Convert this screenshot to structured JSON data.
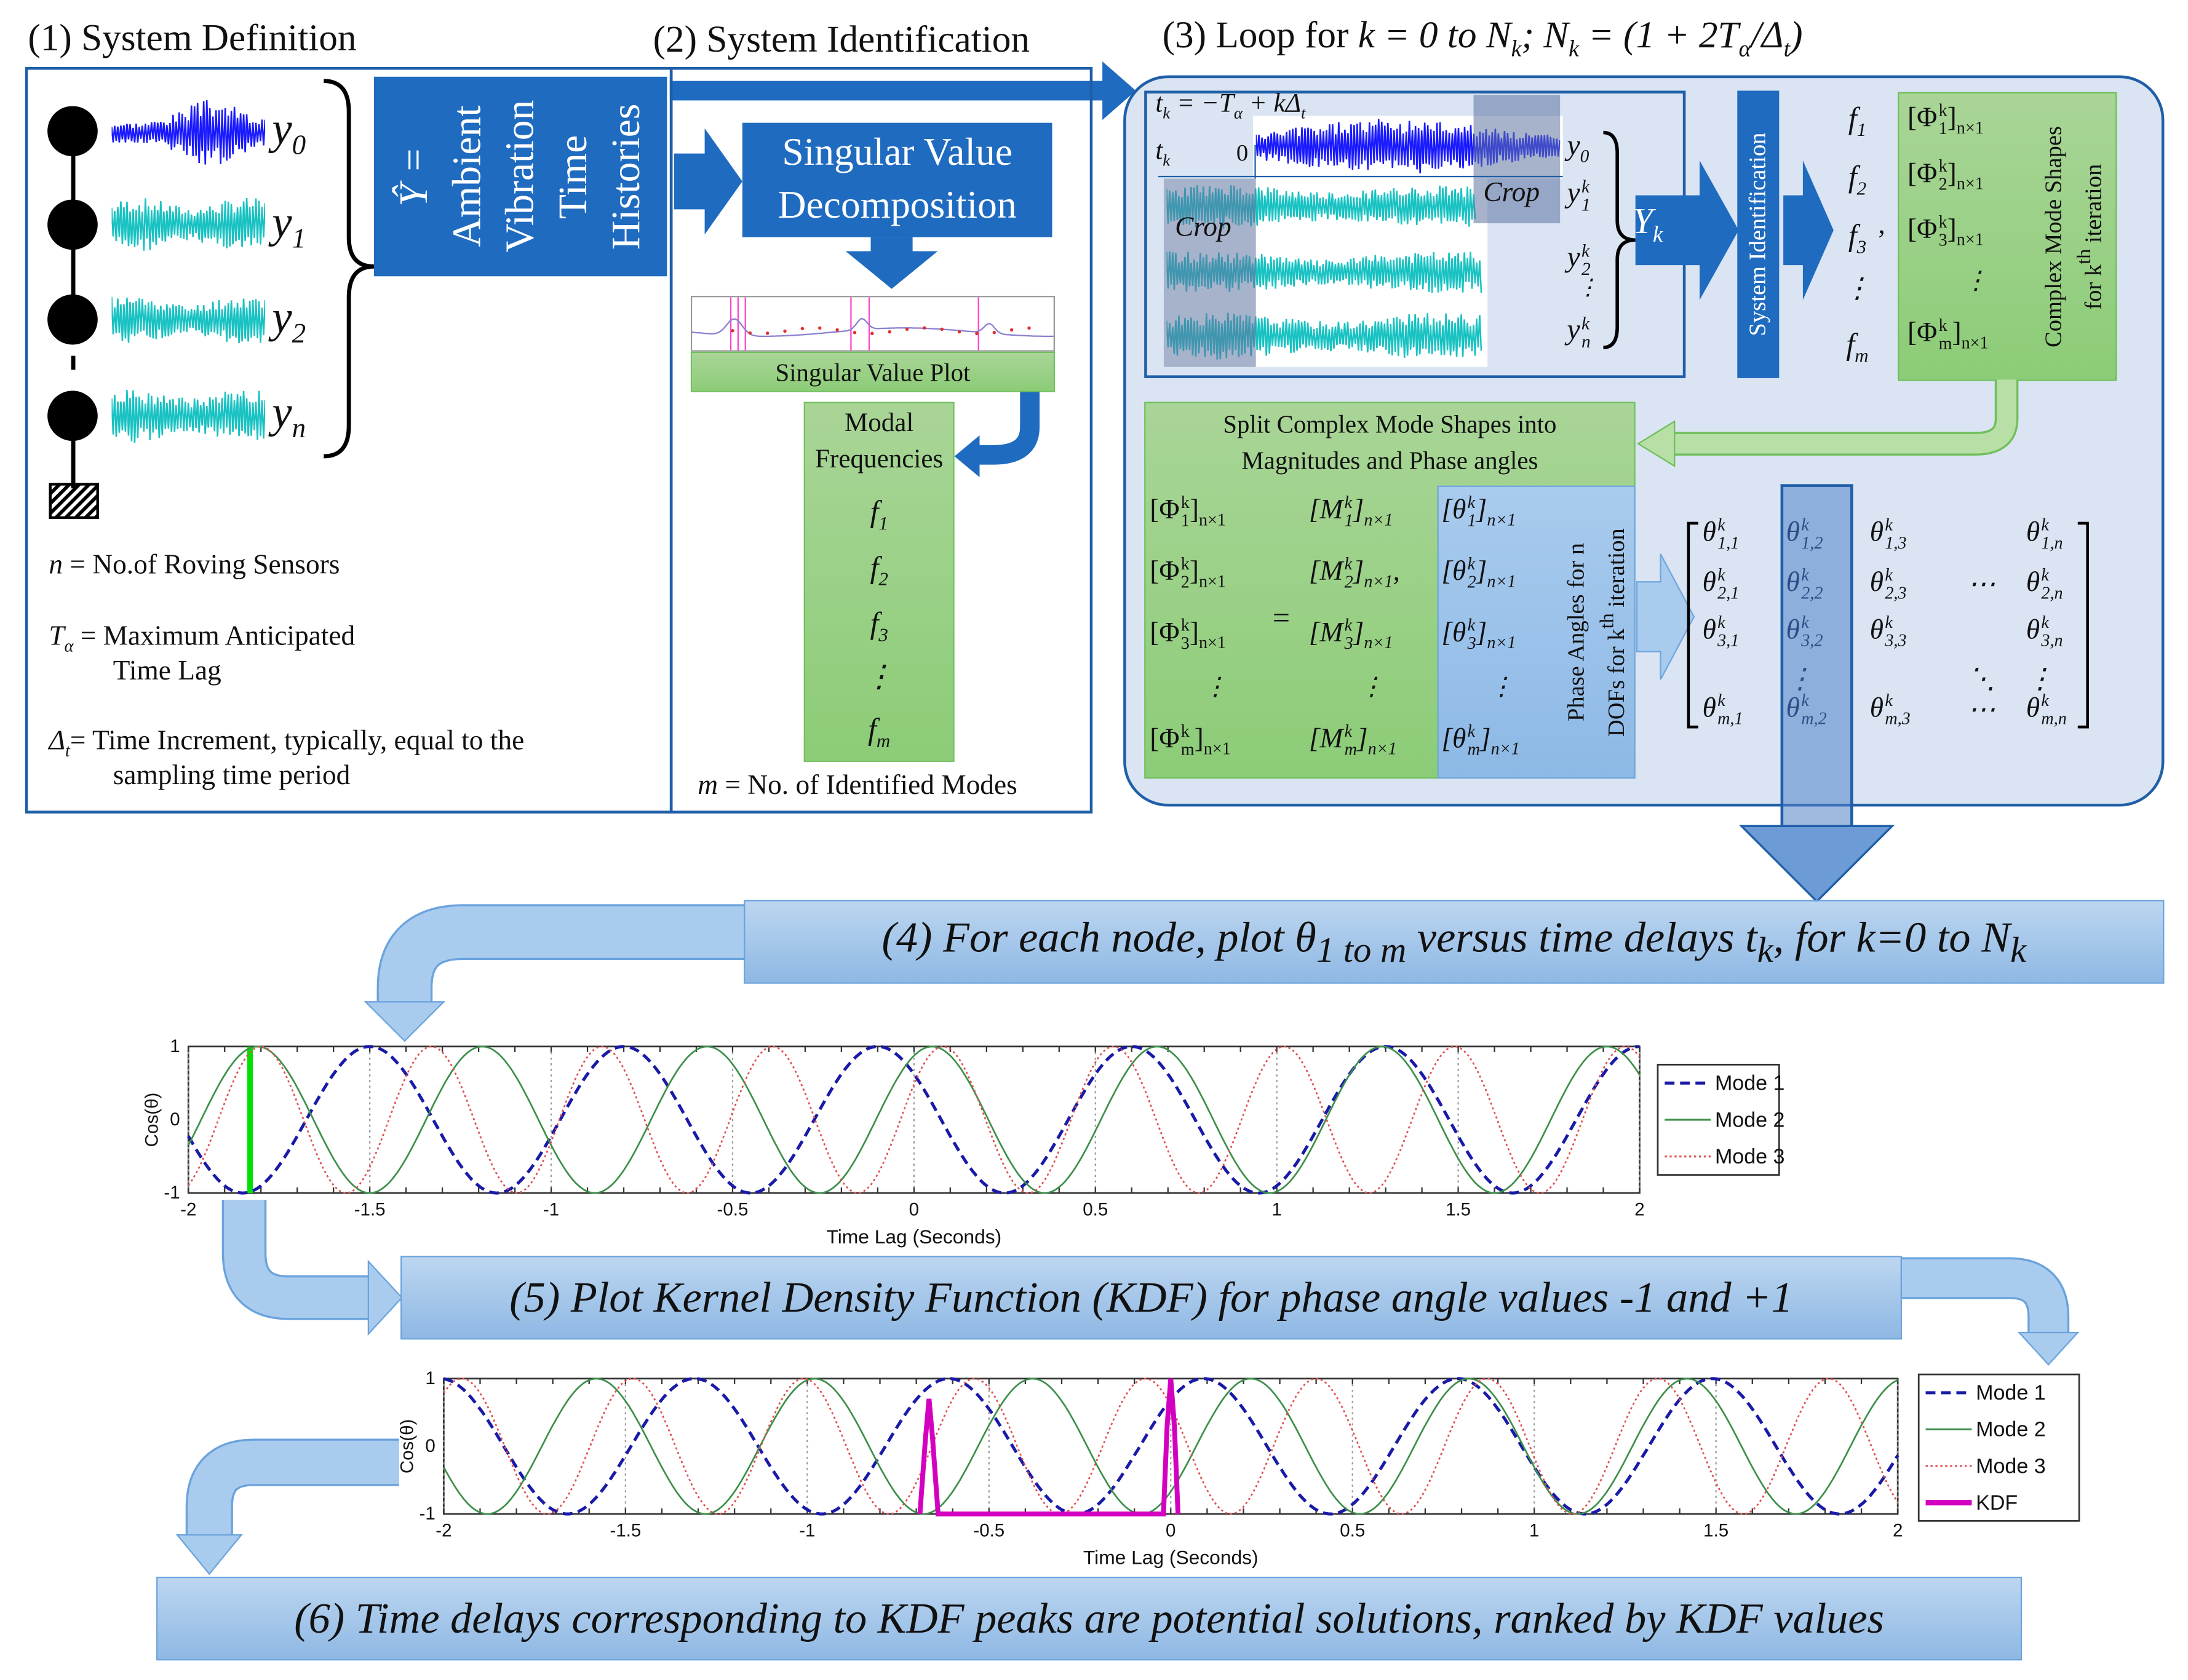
{
  "section1": {
    "title": "(1) System Definition",
    "sensors": [
      [
        {
          "t": "y",
          "sub": "0"
        }
      ],
      [
        {
          "t": "y",
          "sub": "1"
        }
      ],
      [
        {
          "t": "y",
          "sub": "2"
        }
      ],
      [
        {
          "t": "y",
          "sub": "n"
        }
      ]
    ],
    "yhat": {
      "symbol": "Ŷ =",
      "lines": [
        "Ambient",
        "Vibration",
        "Time",
        "Histories"
      ]
    },
    "definitions": [
      {
        "sym": [
          {
            "t": "n"
          }
        ],
        "text": "= No.of Roving Sensors",
        "text2": ""
      },
      {
        "sym": [
          {
            "t": "T",
            "sub": "α"
          }
        ],
        "text": "= Maximum Anticipated",
        "text2": "Time Lag"
      },
      {
        "sym": [
          {
            "t": "Δ",
            "sub": "t"
          }
        ],
        "text": "= Time Increment, typically, equal to the",
        "text2": "sampling time period"
      }
    ],
    "colors": {
      "reference_signal": "#1a1aff",
      "roving_signal": "#19c2c2"
    }
  },
  "section2": {
    "title": "(2) System Identification",
    "svd_lines": [
      "Singular Value",
      "Decomposition"
    ],
    "sv_plot_label": "Singular Value Plot",
    "modal_title": [
      "Modal",
      "Frequencies"
    ],
    "frequencies": [
      [
        {
          "t": "f",
          "sub": "1"
        }
      ],
      [
        {
          "t": "f",
          "sub": "2"
        }
      ],
      [
        {
          "t": "f",
          "sub": "3"
        }
      ],
      [
        {
          "t": "⋮"
        }
      ],
      [
        {
          "t": "f",
          "sub": "m"
        }
      ]
    ],
    "footnote_sym": [
      {
        "t": "m"
      }
    ],
    "footnote_text": "= No. of Identified Modes"
  },
  "section3": {
    "title_prefix": "(3) Loop for ",
    "title_math": [
      {
        "t": "k"
      },
      {
        "t": " = 0 "
      },
      {
        "t": "to N",
        "sub": "k"
      },
      {
        "t": "; N",
        "sub": "k"
      },
      {
        "t": " = (1 + 2T",
        "sub": "α"
      },
      {
        "t": "/Δ",
        "sub": "t"
      },
      {
        "t": ")"
      }
    ],
    "tk_equation": [
      {
        "t": "t",
        "sub": "k"
      },
      {
        "t": " = −T",
        "sub": "α"
      },
      {
        "t": " + kΔ",
        "sub": "t"
      }
    ],
    "tk_axis": [
      {
        "t": "t",
        "sub": "k"
      }
    ],
    "zero": "0",
    "crop_label": "Crop",
    "signal_labels": [
      [
        {
          "t": "y",
          "sub": "0"
        }
      ],
      [
        {
          "t": "y",
          "sup": "k",
          "sub": "1"
        }
      ],
      [
        {
          "t": "y",
          "sup": "k",
          "sub": "2"
        }
      ],
      [
        {
          "t": "⋮"
        }
      ],
      [
        {
          "t": "y",
          "sup": "k",
          "sub": "n"
        }
      ]
    ],
    "yk": [
      {
        "t": "Y",
        "sub": "k"
      }
    ],
    "sysid_label": "System Identification",
    "frequencies": [
      [
        {
          "t": "f",
          "sub": "1"
        }
      ],
      [
        {
          "t": "f",
          "sub": "2"
        }
      ],
      [
        {
          "t": "f",
          "sub": "3"
        }
      ],
      [
        {
          "t": "⋮"
        }
      ],
      [
        {
          "t": "f",
          "sub": "m"
        }
      ]
    ],
    "comma": ",",
    "mode_shapes": [
      [
        {
          "t": "[Φ",
          "sup": "k",
          "sub": "1"
        },
        {
          "t": "]",
          "sub": "n×1"
        }
      ],
      [
        {
          "t": "[Φ",
          "sup": "k",
          "sub": "2"
        },
        {
          "t": "]",
          "sub": "n×1"
        }
      ],
      [
        {
          "t": "[Φ",
          "sup": "k",
          "sub": "3"
        },
        {
          "t": "]",
          "sub": "n×1"
        }
      ],
      [
        {
          "t": "⋮"
        }
      ],
      [
        {
          "t": "[Φ",
          "sup": "k",
          "sub": "m"
        },
        {
          "t": "]",
          "sub": "n×1"
        }
      ]
    ],
    "complex_label": [
      [
        {
          "t": "Complex Mode Shapes"
        }
      ],
      [
        {
          "t": "for k",
          "sup": "th"
        },
        {
          "t": " iteration"
        }
      ]
    ],
    "split_title": [
      "Split Complex Mode Shapes into",
      "Magnitudes and Phase angles"
    ],
    "phi_column": [
      [
        {
          "t": "[Φ",
          "sup": "k",
          "sub": "1"
        },
        {
          "t": "]",
          "sub": "n×1"
        }
      ],
      [
        {
          "t": "[Φ",
          "sup": "k",
          "sub": "2"
        },
        {
          "t": "]",
          "sub": "n×1"
        }
      ],
      [
        {
          "t": "[Φ",
          "sup": "k",
          "sub": "3"
        },
        {
          "t": "]",
          "sub": "n×1"
        }
      ],
      [
        {
          "t": "⋮"
        }
      ],
      [
        {
          "t": "[Φ",
          "sup": "k",
          "sub": "m"
        },
        {
          "t": "]",
          "sub": "n×1"
        }
      ]
    ],
    "equals": "=",
    "m_column": [
      [
        {
          "t": "[M",
          "sup": "k",
          "sub": "1"
        },
        {
          "t": "]",
          "sub": "n×1"
        }
      ],
      [
        {
          "t": "[M",
          "sup": "k",
          "sub": "2"
        },
        {
          "t": "]",
          "sub": "n×1"
        },
        {
          "t": ","
        }
      ],
      [
        {
          "t": "[M",
          "sup": "k",
          "sub": "3"
        },
        {
          "t": "]",
          "sub": "n×1"
        }
      ],
      [
        {
          "t": "⋮"
        }
      ],
      [
        {
          "t": "[M",
          "sup": "k",
          "sub": "m"
        },
        {
          "t": "]",
          "sub": "n×1"
        }
      ]
    ],
    "theta_column": [
      [
        {
          "t": "[θ",
          "sup": "k",
          "sub": "1"
        },
        {
          "t": "]",
          "sub": "n×1"
        }
      ],
      [
        {
          "t": "[θ",
          "sup": "k",
          "sub": "2"
        },
        {
          "t": "]",
          "sub": "n×1"
        }
      ],
      [
        {
          "t": "[θ",
          "sup": "k",
          "sub": "3"
        },
        {
          "t": "]",
          "sub": "n×1"
        }
      ],
      [
        {
          "t": "⋮"
        }
      ],
      [
        {
          "t": "[θ",
          "sup": "k",
          "sub": "m"
        },
        {
          "t": "]",
          "sub": "n×1"
        }
      ]
    ],
    "phase_label": [
      [
        {
          "t": "Phase Angles for n"
        }
      ],
      [
        {
          "t": "DOFs for k",
          "sup": "th"
        },
        {
          "t": " iteration"
        }
      ]
    ],
    "matrix": [
      [
        [
          {
            "t": "θ",
            "sup": "k",
            "sub": "1,1"
          }
        ],
        [
          {
            "t": "θ",
            "sup": "k",
            "sub": "1,2"
          }
        ],
        [
          {
            "t": "θ",
            "sup": "k",
            "sub": "1,3"
          }
        ],
        [
          {
            "t": ""
          }
        ],
        [
          {
            "t": "θ",
            "sup": "k",
            "sub": "1,n"
          }
        ]
      ],
      [
        [
          {
            "t": "θ",
            "sup": "k",
            "sub": "2,1"
          }
        ],
        [
          {
            "t": "θ",
            "sup": "k",
            "sub": "2,2"
          }
        ],
        [
          {
            "t": "θ",
            "sup": "k",
            "sub": "2,3"
          }
        ],
        [
          {
            "t": "⋯"
          }
        ],
        [
          {
            "t": "θ",
            "sup": "k",
            "sub": "2,n"
          }
        ]
      ],
      [
        [
          {
            "t": "θ",
            "sup": "k",
            "sub": "3,1"
          }
        ],
        [
          {
            "t": "θ",
            "sup": "k",
            "sub": "3,2"
          }
        ],
        [
          {
            "t": "θ",
            "sup": "k",
            "sub": "3,3"
          }
        ],
        [
          {
            "t": ""
          }
        ],
        [
          {
            "t": "θ",
            "sup": "k",
            "sub": "3,n"
          }
        ]
      ],
      [
        [
          {
            "t": ""
          }
        ],
        [
          {
            "t": "⋮"
          }
        ],
        [
          {
            "t": ""
          }
        ],
        [
          {
            "t": "⋱"
          }
        ],
        [
          {
            "t": "⋮"
          }
        ]
      ],
      [
        [
          {
            "t": "θ",
            "sup": "k",
            "sub": "m,1"
          }
        ],
        [
          {
            "t": "θ",
            "sup": "k",
            "sub": "m,2"
          }
        ],
        [
          {
            "t": "θ",
            "sup": "k",
            "sub": "m,3"
          }
        ],
        [
          {
            "t": "⋯"
          }
        ],
        [
          {
            "t": "θ",
            "sup": "k",
            "sub": "m,n"
          }
        ]
      ]
    ]
  },
  "banners": {
    "step4": [
      {
        "t": "(4) For each node, plot "
      },
      {
        "t": "θ",
        "sub": "1 to m"
      },
      {
        "t": " versus time delays "
      },
      {
        "t": "t",
        "sub": "k"
      },
      {
        "t": ", for k=0 to N",
        "sub": "k"
      }
    ],
    "step5": [
      {
        "t": "(5) Plot Kernel Density Function (KDF) for phase angle values -1 and +1"
      }
    ],
    "step6": [
      {
        "t": "(6) Time delays corresponding to KDF peaks are potential solutions, ranked by KDF values"
      }
    ]
  },
  "colors": {
    "dark_blue": "#1f6bc0",
    "green_box": "#9bd184",
    "light_blue": "#9dc3e6",
    "border_blue": "#1f5fa8",
    "loop_fill": "#dae4f3"
  },
  "chart_data": [
    {
      "type": "line",
      "xlabel": "Time Lag (Seconds)",
      "ylabel": "Cos(θ)",
      "xlim": [
        -2,
        2
      ],
      "ylim": [
        -1,
        1
      ],
      "xticks": [
        "-2",
        "-1.5",
        "-1",
        "-0.5",
        "0",
        "0.5",
        "1",
        "1.5",
        "2"
      ],
      "yticks": [
        "-1",
        "0",
        "1"
      ],
      "grid": "vertical dotted",
      "legend_position": "right",
      "series": [
        {
          "name": "Mode 1",
          "function": "cos",
          "period": 0.7,
          "peak_at": -1.5,
          "color": "#1a1aa8",
          "style": "dashed"
        },
        {
          "name": "Mode 2",
          "function": "cos",
          "period": 0.62,
          "peak_at": -1.19,
          "color": "#3d8f4a",
          "style": "solid"
        },
        {
          "name": "Mode 3",
          "function": "cos",
          "period": 0.47,
          "peak_at": -1.8,
          "color": "#e05050",
          "style": "dotted"
        }
      ],
      "marker_line": {
        "x": -1.83,
        "color": "#00e000"
      }
    },
    {
      "type": "line",
      "xlabel": "Time Lag (Seconds)",
      "ylabel": "Cos(θ)",
      "xlim": [
        -2,
        2
      ],
      "ylim": [
        -1,
        1
      ],
      "xticks": [
        "-2",
        "-1.5",
        "-1",
        "-0.5",
        "0",
        "0.5",
        "1",
        "1.5",
        "2"
      ],
      "yticks": [
        "-1",
        "0",
        "1"
      ],
      "grid": "vertical dotted",
      "legend_position": "right",
      "series": [
        {
          "name": "Mode 1",
          "function": "cos",
          "period": 0.7,
          "peak_at": -1.31,
          "color": "#1a1aa8",
          "style": "dashed"
        },
        {
          "name": "Mode 2",
          "function": "cos",
          "period": 0.6,
          "peak_at": -1.58,
          "color": "#3d8f4a",
          "style": "solid"
        },
        {
          "name": "Mode 3",
          "function": "cos",
          "period": 0.47,
          "peak_at": -1.95,
          "color": "#e05050",
          "style": "dotted"
        },
        {
          "name": "KDF",
          "color": "#d400c0",
          "style": "solid",
          "x": [
            -0.69,
            -0.675,
            -0.665,
            -0.655,
            -0.64,
            -0.63,
            -0.02,
            -0.01,
            0.0,
            0.01,
            0.02
          ],
          "y": [
            -1,
            0.1,
            0.7,
            0.1,
            -1,
            -1,
            -1,
            0.3,
            1.0,
            0.3,
            -1
          ]
        }
      ]
    }
  ]
}
